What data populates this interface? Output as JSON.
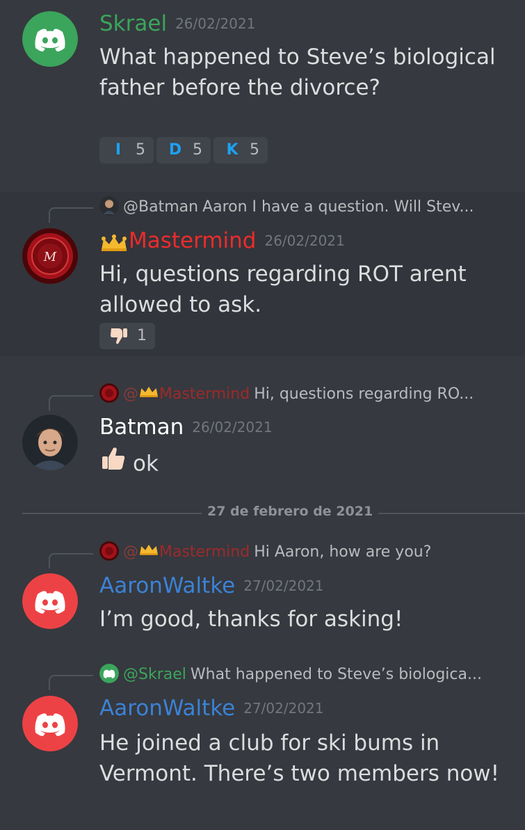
{
  "colors": {
    "background": "#36393f",
    "skrael": "#3ba55c",
    "mastermind": "#ed2b2b",
    "aaron": "#3b82d6",
    "batman": "#ffffff",
    "timestamp": "#72767d",
    "mention_bg": "#3e4170"
  },
  "messages": [
    {
      "author": "Skrael",
      "timestamp": "26/02/2021",
      "text": "What happened to Steve’s biological father before the divorce?",
      "avatar": "discord-logo-green",
      "reactions": [
        {
          "emoji": "regional-indicator-i",
          "glyph": "I",
          "count": "5"
        },
        {
          "emoji": "regional-indicator-d",
          "glyph": "D",
          "count": "5"
        },
        {
          "emoji": "regional-indicator-k",
          "glyph": "K",
          "count": "5"
        }
      ]
    },
    {
      "reply_to": {
        "name": "@Batman",
        "preview": "Aaron I have a question. Will Stev..."
      },
      "author": "Mastermind",
      "timestamp": "26/02/2021",
      "text": "Hi, questions regarding ROT arent allowed to ask.",
      "avatar": "red-seal",
      "reactions": [
        {
          "emoji": "thumbs-down",
          "count": "1"
        }
      ]
    },
    {
      "reply_to": {
        "at": "@",
        "name": "Mastermind",
        "preview": "Hi, questions regarding RO..."
      },
      "author": "Batman",
      "timestamp": "26/02/2021",
      "text": "ok",
      "avatar": "animated-character"
    },
    {
      "reply_to": {
        "at": "@",
        "name": "Mastermind",
        "preview": "Hi Aaron, how are you?"
      },
      "author": "AaronWaltke",
      "timestamp": "27/02/2021",
      "text": "I’m good, thanks for asking!",
      "avatar": "discord-logo-red"
    },
    {
      "reply_to": {
        "name": "@Skrael",
        "preview": "What happened to Steve’s biologica..."
      },
      "author": "AaronWaltke",
      "timestamp": "27/02/2021",
      "text": "He joined a club for ski bums in Vermont. There’s two members now!",
      "avatar": "discord-logo-red"
    }
  ],
  "date_divider": "27 de febrero de 2021"
}
